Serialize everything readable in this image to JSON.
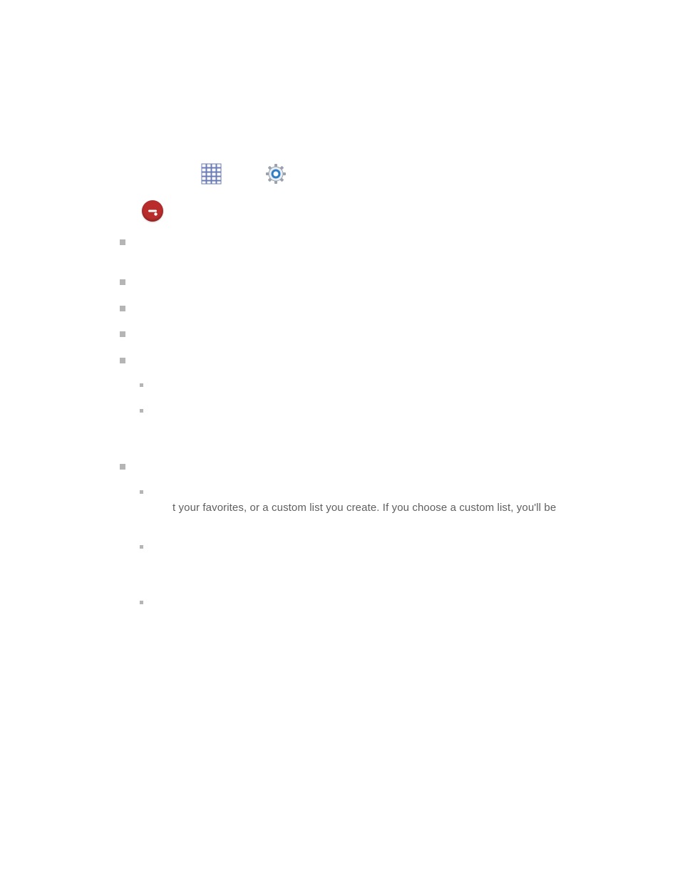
{
  "icons": {
    "grid": "grid-icon",
    "gear": "gear-icon",
    "dnd": "do-not-disturb-icon"
  },
  "text": {
    "fragment": "t your favorites, or a custom list you create. If you choose a custom list, you'll be"
  },
  "bullets": {
    "level1_positions": [
      336,
      392,
      429,
      465,
      502,
      651
    ],
    "level2_positions": [
      538,
      574,
      688,
      765,
      843
    ]
  }
}
